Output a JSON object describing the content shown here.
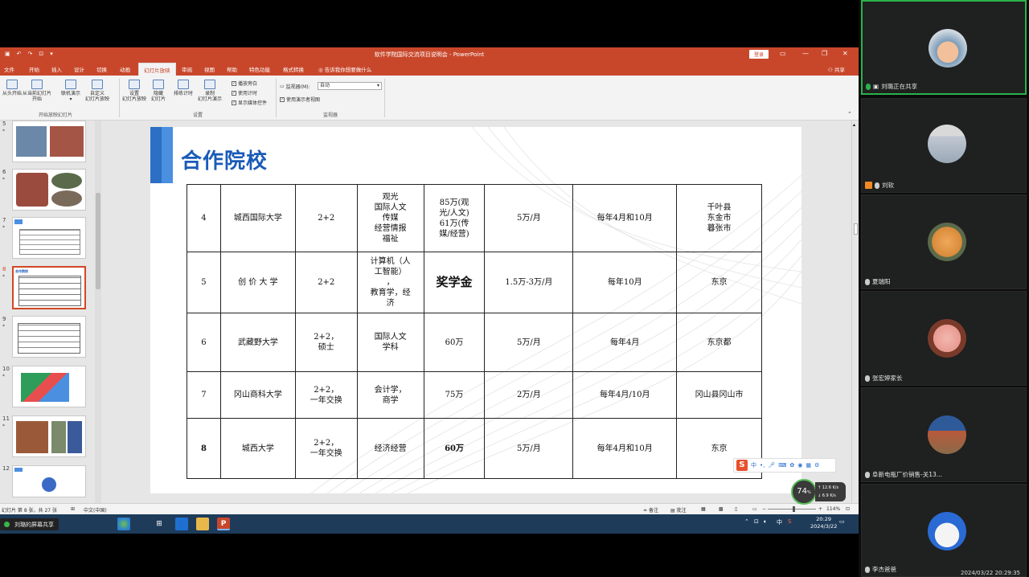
{
  "ppt": {
    "window_title": "软件学院国际交流项目说明会 - PowerPoint",
    "login_label": "登录",
    "menu_tabs": [
      "文件",
      "开始",
      "插入",
      "设计",
      "切换",
      "动画",
      "幻灯片放映",
      "审阅",
      "视图",
      "帮助",
      "特色功能",
      "格式转换"
    ],
    "active_tab": "幻灯片放映",
    "tell_me": "告诉我你想要做什么",
    "share": "共享",
    "ribbon": {
      "btn_from_start": "从头开始",
      "btn_from_current_1": "从当前幻灯片",
      "btn_from_current_2": "开始",
      "btn_online_1": "联机演示",
      "btn_custom_1": "自定义",
      "btn_custom_2": "幻灯片放映",
      "group_start": "开始放映幻灯片",
      "btn_setup_1": "设置",
      "btn_setup_2": "幻灯片放映",
      "btn_hide_1": "隐藏",
      "btn_hide_2": "幻灯片",
      "btn_rehearse": "排练计时",
      "btn_record_1": "录制",
      "btn_record_2": "幻灯片演示",
      "chk_narration": "播放旁白",
      "chk_timing": "使用计时",
      "chk_media": "显示媒体控件",
      "group_setup": "设置",
      "monitor_label": "监视器(M):",
      "monitor_value": "自动",
      "chk_presenter": "使用演示者视图",
      "group_monitor": "监视器"
    },
    "thumb_numbers": [
      "5",
      "6",
      "7",
      "8",
      "9",
      "10",
      "11",
      "12"
    ],
    "selected_thumb": "8",
    "thumb_mini_title": "合作院校",
    "slide_title": "合作院校",
    "table_rows": [
      {
        "no": "4",
        "school": "城西国际大学",
        "mode": "2+2",
        "major": "观光\n国际人文\n传媒\n经营情报\n福祉",
        "tuition": "85万(观\n光/人文)\n61万(传\n媒/经营)",
        "living": "5万/月",
        "intake": "每年4月和10月",
        "city": "千叶县\n东金市\n暮张市"
      },
      {
        "no": "5",
        "school": "创 价 大 学",
        "mode": "2+2",
        "major": "计算机（人\n工智能）\n，\n教育学，经\n济",
        "tuition": "奖学金",
        "living": "1.5万-3万/月",
        "intake": "每年10月",
        "city": "东京"
      },
      {
        "no": "6",
        "school": "武藏野大学",
        "mode": "2+2，\n硕士",
        "major": "国际人文\n学科",
        "tuition": "60万",
        "living": "5万/月",
        "intake": "每年4月",
        "city": "东京都"
      },
      {
        "no": "7",
        "school": "冈山商科大学",
        "mode": "2+2，\n一年交换",
        "major": "会计学，\n商学",
        "tuition": "75万",
        "living": "2万/月",
        "intake": "每年4月/10月",
        "city": "冈山县冈山市"
      },
      {
        "no": "8",
        "school": "城西大学",
        "mode": "2+2，\n一年交换",
        "major": "经济经营",
        "tuition": "60万",
        "living": "5万/月",
        "intake": "每年4月和10月",
        "city": "东京"
      }
    ],
    "status": {
      "slide_info": "幻灯片 第 8 张，共 27 张",
      "language": "中文(中国)",
      "notes": "备注",
      "comments": "批注",
      "zoom": "114%"
    }
  },
  "ime": {
    "label": "中"
  },
  "net": {
    "percent": "74",
    "percent_unit": "%",
    "up": "12.6",
    "up_unit": "K/s",
    "down": "6.9",
    "down_unit": "K/s"
  },
  "taskbar": {
    "tray_lang": "中",
    "time": "20:29",
    "date": "2024/3/22"
  },
  "share_bar": "刘璐的屏幕共享",
  "participants": [
    {
      "name": "刘璐正在共享",
      "state": "sharing"
    },
    {
      "name": "刘软",
      "state": "hand"
    },
    {
      "name": "夏瑞阳",
      "state": "normal"
    },
    {
      "name": "张宏婷家长",
      "state": "normal"
    },
    {
      "name": "阜新电瓶厂价销售-关13...",
      "state": "normal"
    },
    {
      "name": "李杰爸爸",
      "state": "normal"
    }
  ],
  "meeting_timestamp": "2024/03/22 20:29:35",
  "colors": {
    "ppt_accent": "#c8472b",
    "slide_title": "#1a5bb8",
    "share_green": "#2ab24c"
  }
}
